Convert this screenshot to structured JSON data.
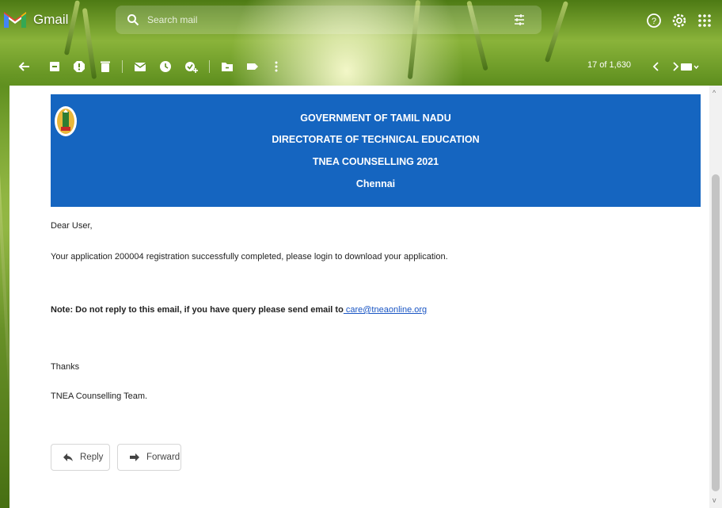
{
  "app": {
    "name": "Gmail",
    "search_placeholder": "Search mail"
  },
  "toolbar": {
    "counter": "17 of 1,630"
  },
  "email": {
    "banner": {
      "line1": "GOVERNMENT OF TAMIL NADU",
      "line2": "DIRECTORATE OF TECHNICAL EDUCATION",
      "line3": "TNEA COUNSELLING 2021",
      "line4": "Chennai"
    },
    "greeting": "Dear User,",
    "body": "Your application 200004 registration successfully completed, please login to download your application.",
    "note_label": "Note: Do not reply to this email, if you have query please send email to",
    "note_email": " care@tneaonline.org",
    "thanks": "Thanks",
    "signature": "TNEA Counselling Team."
  },
  "actions": {
    "reply": "Reply",
    "forward": "Forward"
  },
  "colors": {
    "banner": "#1565c0",
    "link": "#1a56c4",
    "theme_green": "#6f9a2a"
  },
  "icons": [
    "gmail-logo",
    "search-icon",
    "search-options-icon",
    "help-icon",
    "settings-icon",
    "apps-icon",
    "back-icon",
    "archive-icon",
    "report-spam-icon",
    "delete-icon",
    "mark-unread-icon",
    "snooze-icon",
    "add-task-icon",
    "move-to-icon",
    "label-icon",
    "more-icon",
    "newer-icon",
    "older-icon",
    "input-tools-icon",
    "tn-emblem",
    "reply-icon",
    "forward-icon"
  ]
}
